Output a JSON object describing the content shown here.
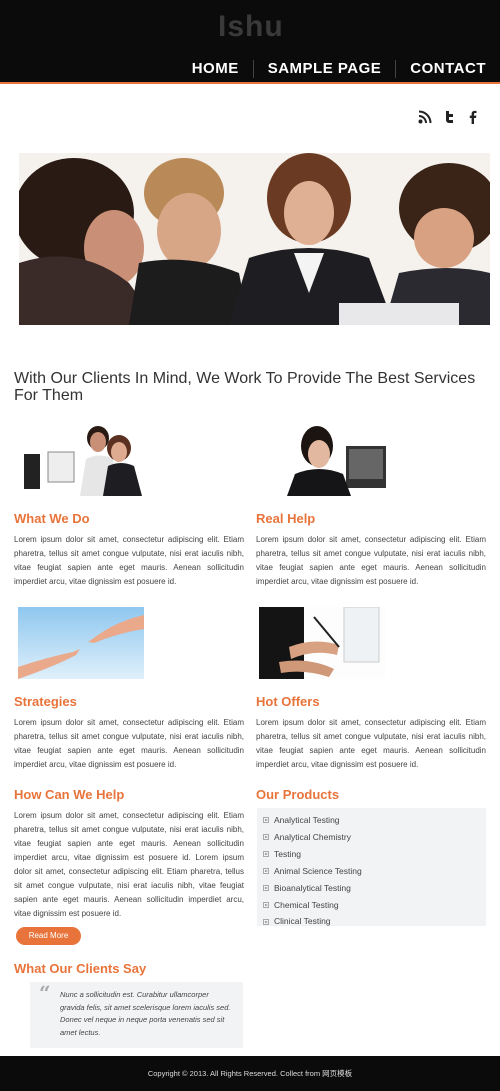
{
  "site": {
    "logo": "Ishu",
    "nav": [
      {
        "label": "HOME"
      },
      {
        "label": "SAMPLE PAGE"
      },
      {
        "label": "CONTACT"
      }
    ],
    "social_icons": [
      "rss-icon",
      "twitter-icon",
      "facebook-icon"
    ]
  },
  "intro": "With Our Clients In Mind, We Work To Provide The Best Services For Them",
  "sections": {
    "what_we_do": {
      "title": "What We Do",
      "text": "Lorem ipsum dolor sit amet, consectetur adipiscing elit. Etiam pharetra, tellus sit amet congue vulputate, nisi erat iaculis nibh, vitae feugiat sapien ante eget mauris. Aenean sollicitudin imperdiet arcu, vitae dignissim est posuere id."
    },
    "real_help": {
      "title": "Real Help",
      "text": "Lorem ipsum dolor sit amet, consectetur adipiscing elit. Etiam pharetra, tellus sit amet congue vulputate, nisi erat iaculis nibh, vitae feugiat sapien ante eget mauris. Aenean sollicitudin imperdiet arcu, vitae dignissim est posuere id."
    },
    "strategies": {
      "title": "Strategies",
      "text": "Lorem ipsum dolor sit amet, consectetur adipiscing elit. Etiam pharetra, tellus sit amet congue vulputate, nisi erat iaculis nibh, vitae feugiat sapien ante eget mauris. Aenean sollicitudin imperdiet arcu, vitae dignissim est posuere id."
    },
    "hot_offers": {
      "title": "Hot Offers",
      "text": "Lorem ipsum dolor sit amet, consectetur adipiscing elit. Etiam pharetra, tellus sit amet congue vulputate, nisi erat iaculis nibh, vitae feugiat sapien ante eget mauris. Aenean sollicitudin imperdiet arcu, vitae dignissim est posuere id."
    },
    "how_can_we_help": {
      "title": "How Can We Help",
      "text": "Lorem ipsum dolor sit amet, consectetur adipiscing elit. Etiam pharetra, tellus sit amet congue vulputate, nisi erat iaculis nibh, vitae feugiat sapien ante eget mauris. Aenean sollicitudin imperdiet arcu, vitae dignissim est posuere id. Lorem ipsum dolor sit amet, consectetur adipiscing elit. Etiam pharetra, tellus sit amet congue vulputate, nisi erat iaculis nibh, vitae feugiat sapien ante eget mauris. Aenean sollicitudin imperdiet arcu, vitae dignissim est posuere id.",
      "button": "Read More"
    },
    "our_products": {
      "title": "Our Products",
      "items": [
        "Analytical Testing",
        "Analytical Chemistry",
        "Testing",
        "Animal Science Testing",
        "Bioanalytical Testing",
        "Chemical Testing",
        "Clinical Testing"
      ]
    },
    "clients_say": {
      "title": "What Our Clients Say",
      "quote": "Nunc a sollicitudin est. Curabitur ullamcorper gravida felis, sit amet scelerisque lorem iaculis sed. Donec vel neque in neque porta venenatis sed sit amet lectus."
    }
  },
  "footer": "Copyright © 2013. All Rights Reserved. Collect from 网页模板",
  "colors": {
    "accent": "#e8743b",
    "header_bg": "#0b0b0b",
    "panel_bg": "#f2f3f5"
  }
}
